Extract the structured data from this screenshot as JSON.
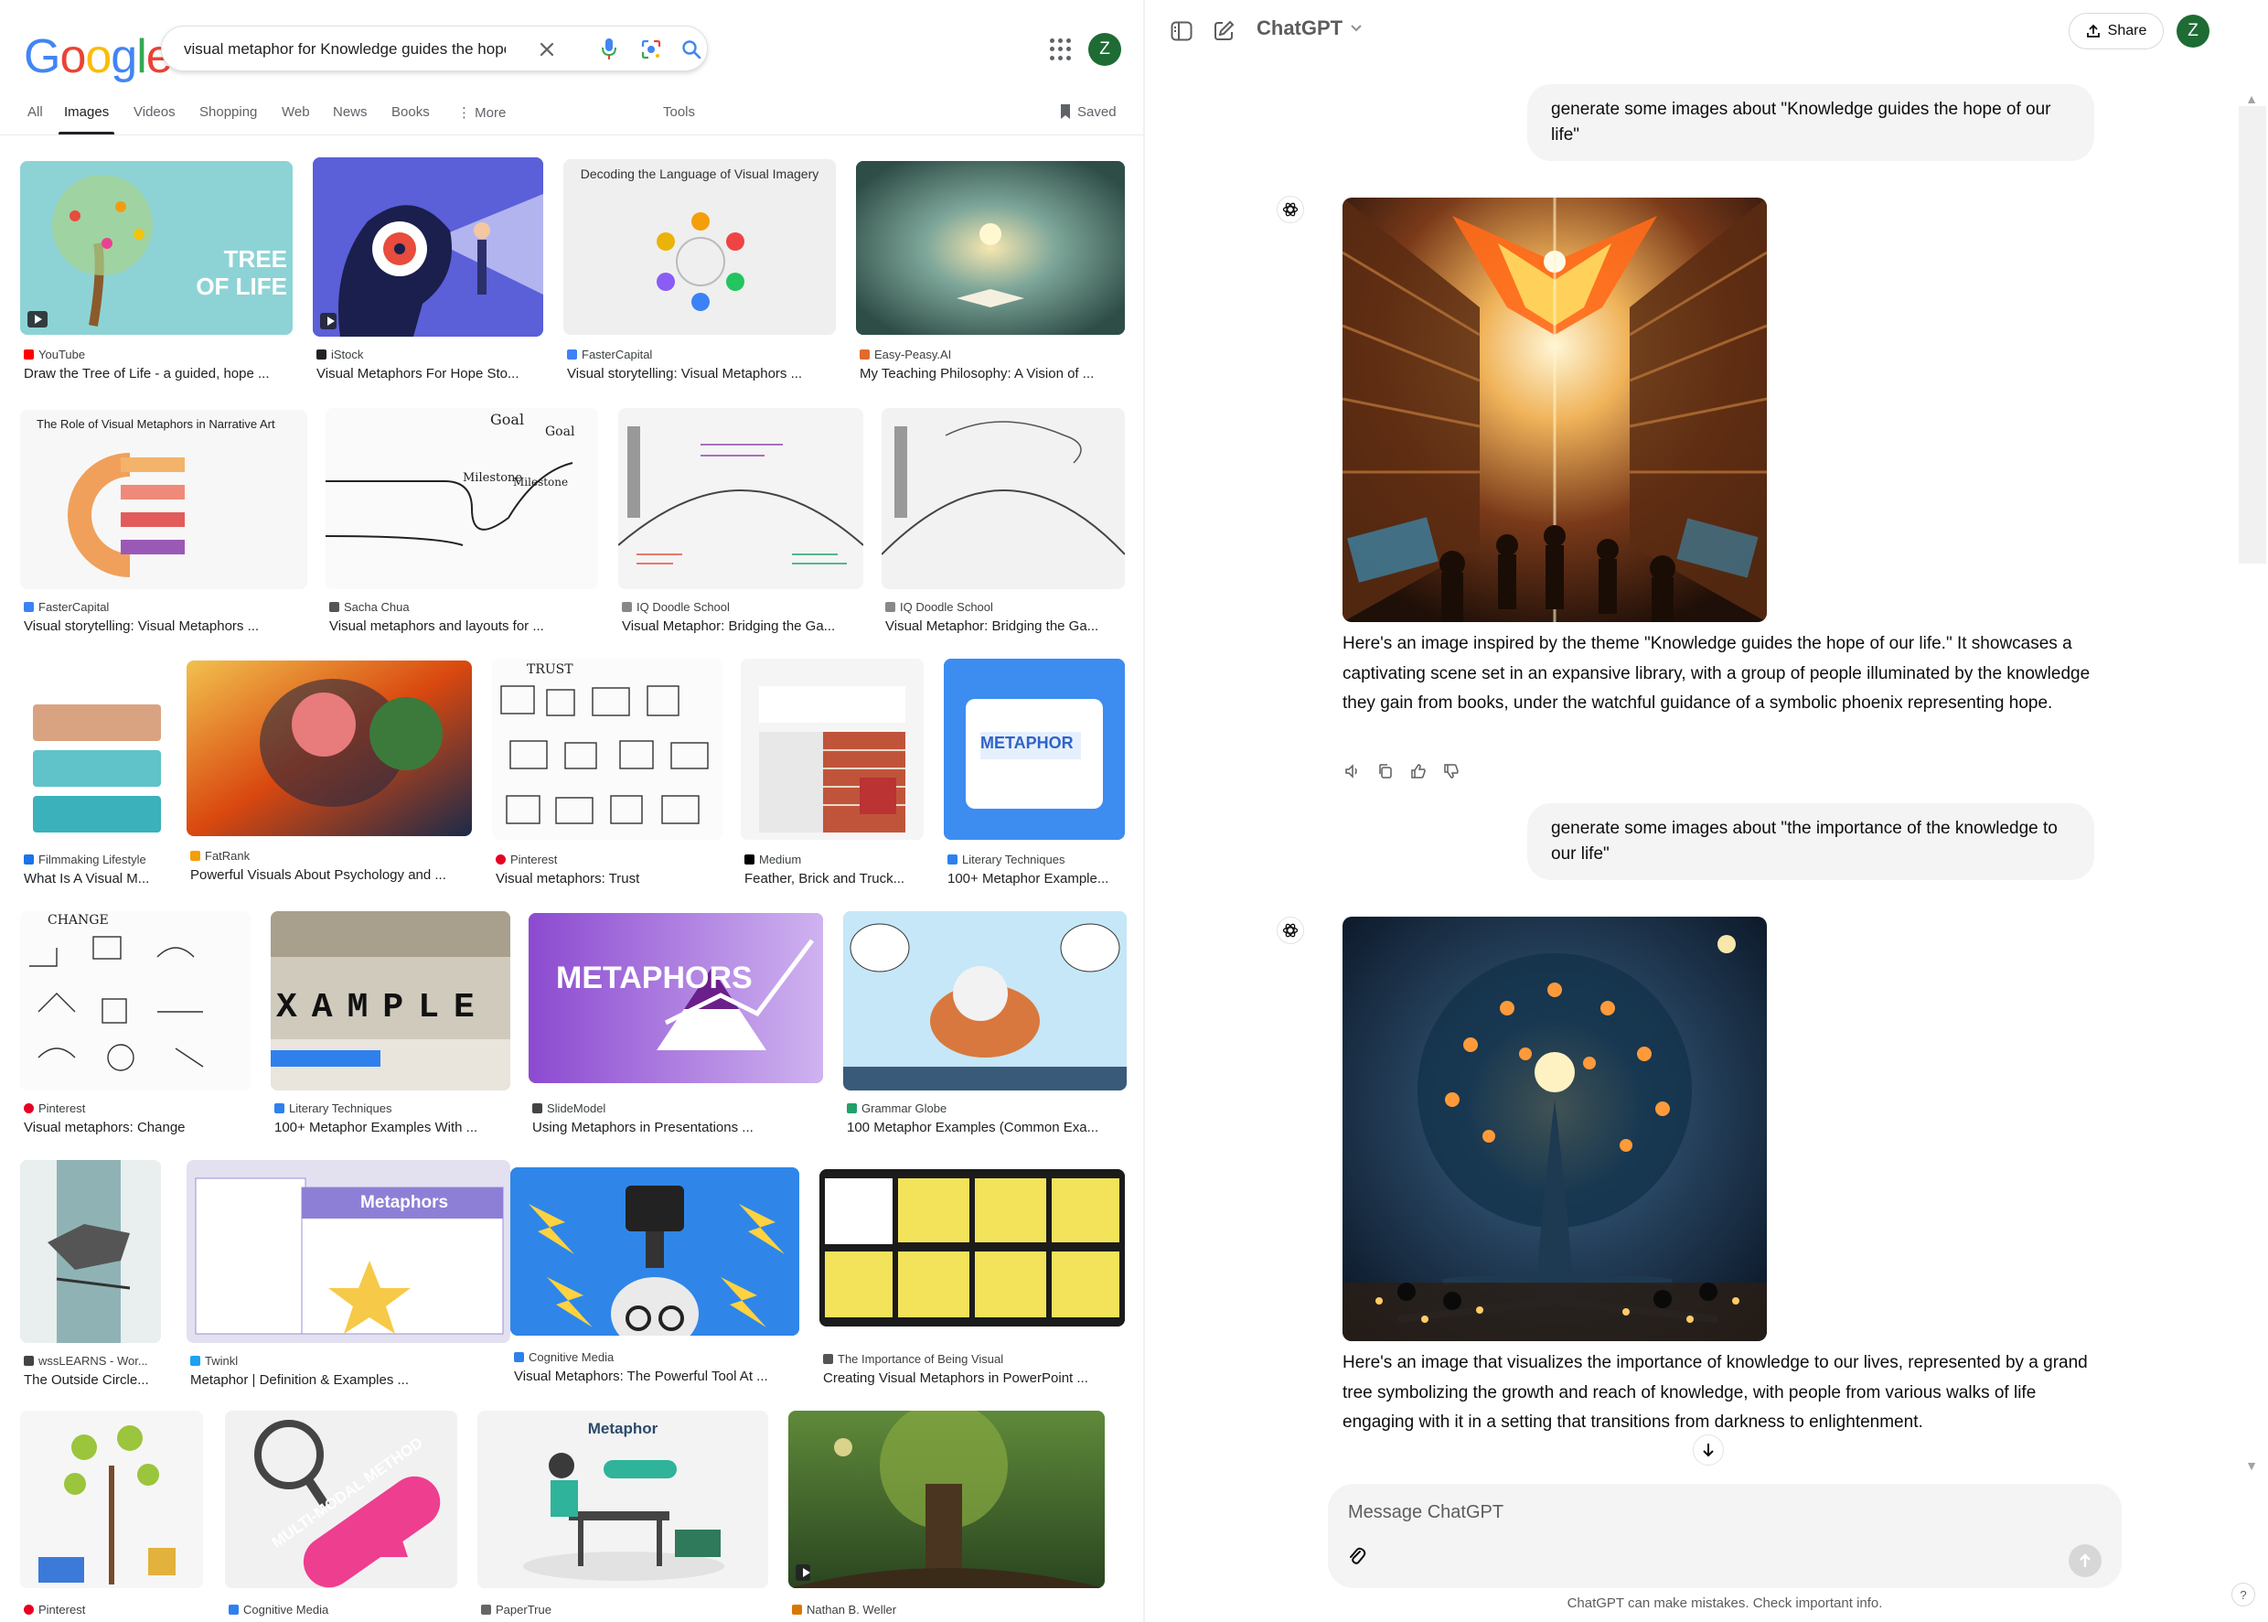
{
  "google": {
    "logo_letters": [
      {
        "ch": "G",
        "color": "#4285F4"
      },
      {
        "ch": "o",
        "color": "#EA4335"
      },
      {
        "ch": "o",
        "color": "#FBBC05"
      },
      {
        "ch": "g",
        "color": "#4285F4"
      },
      {
        "ch": "l",
        "color": "#34A853"
      },
      {
        "ch": "e",
        "color": "#EA4335"
      }
    ],
    "search_query": "visual metaphor for Knowledge guides the hope",
    "avatar_letter": "Z",
    "tabs": [
      "All",
      "Images",
      "Videos",
      "Shopping",
      "Web",
      "News",
      "Books",
      "More",
      "Tools"
    ],
    "active_tab": "Images",
    "saved_label": "Saved",
    "results": [
      {
        "source": "YouTube",
        "title": "Draw the Tree of Life - a guided, hope ...",
        "fav": "#ff0000",
        "thumb_text": "TREE OF LIFE",
        "bg": "#7fcfd0"
      },
      {
        "source": "iStock",
        "title": "Visual Metaphors For Hope Sto...",
        "fav": "#222222",
        "bg": "#5a5fd6"
      },
      {
        "source": "FasterCapital",
        "title": "Visual storytelling: Visual Metaphors ...",
        "fav": "#3b82f6",
        "thumb_text": "Decoding the Language of Visual Imagery",
        "bg": "#efefef"
      },
      {
        "source": "Easy-Peasy.AI",
        "title": "My Teaching Philosophy: A Vision of ...",
        "fav": "#e26a2c",
        "bg": "#3e6a5e"
      },
      {
        "source": "FasterCapital",
        "title": "Visual storytelling: Visual Metaphors ...",
        "fav": "#3b82f6",
        "thumb_text": "The Role of Visual Metaphors in Narrative Art",
        "bg": "#f7f7f7"
      },
      {
        "source": "Sacha Chua",
        "title": "Visual metaphors and layouts for ...",
        "fav": "#555555",
        "bg": "#fafafa"
      },
      {
        "source": "IQ Doodle School",
        "title": "Visual Metaphor: Bridging the Ga...",
        "fav": "#888888",
        "bg": "#f4f4f4"
      },
      {
        "source": "IQ Doodle School",
        "title": "Visual Metaphor: Bridging the Ga...",
        "fav": "#888888",
        "bg": "#f2f2f2"
      },
      {
        "source": "Filmmaking Lifestyle",
        "title": "What Is A Visual M...",
        "fav": "#1a73e8",
        "bg": "#eaf6f8"
      },
      {
        "source": "FatRank",
        "title": "Powerful Visuals About Psychology and ...",
        "fav": "#f59e0b",
        "bg": "#2b2b4a"
      },
      {
        "source": "Pinterest",
        "title": "Visual metaphors: Trust",
        "fav": "#e60023",
        "thumb_text": "TRUST",
        "bg": "#fbfbfb"
      },
      {
        "source": "Medium",
        "title": "Feather, Brick and Truck...",
        "fav": "#000000",
        "bg": "#dcdcdc"
      },
      {
        "source": "Literary Techniques",
        "title": "100+ Metaphor Example...",
        "fav": "#2f80ed",
        "thumb_text": "METAPHOR",
        "bg": "#2f80ed"
      },
      {
        "source": "Pinterest",
        "title": "Visual metaphors: Change",
        "fav": "#e60023",
        "thumb_text": "CHANGE",
        "bg": "#fbfbfb"
      },
      {
        "source": "Literary Techniques",
        "title": "100+ Metaphor Examples With ...",
        "fav": "#2f80ed",
        "thumb_text": "XAMPLE",
        "bg": "#d9d4c8"
      },
      {
        "source": "SlideModel",
        "title": "Using Metaphors in Presentations ...",
        "fav": "#444444",
        "thumb_text": "METAPHORS",
        "bg": "#7b3fb8"
      },
      {
        "source": "Grammar Globe",
        "title": "100 Metaphor Examples (Common Exa...",
        "fav": "#22a06b",
        "bg": "#bfe3f5"
      },
      {
        "source": "wssLEARNS - Wor...",
        "title": "The Outside Circle...",
        "fav": "#444444",
        "bg": "#dfe6e6"
      },
      {
        "source": "Twinkl",
        "title": "Metaphor | Definition & Examples ...",
        "fav": "#1da1f2",
        "thumb_text": "Metaphors",
        "bg": "#e7e4f3"
      },
      {
        "source": "Cognitive Media",
        "title": "Visual Metaphors: The Powerful Tool At ...",
        "fav": "#2f80ed",
        "bg": "#2a7de1"
      },
      {
        "source": "The Importance of Being Visual",
        "title": "Creating Visual Metaphors in PowerPoint ...",
        "fav": "#555555",
        "bg": "#1b1b1b"
      },
      {
        "source": "Pinterest",
        "title": "",
        "fav": "#e60023",
        "bg": "#f5f5f5"
      },
      {
        "source": "Cognitive Media",
        "title": "",
        "fav": "#2f80ed",
        "thumb_text": "MULTI-MODAL METHOD",
        "bg": "#f2f2f2"
      },
      {
        "source": "PaperTrue",
        "title": "",
        "fav": "#666666",
        "thumb_text": "Metaphor",
        "bg": "#f3f3f3"
      },
      {
        "source": "Nathan B. Weller",
        "title": "",
        "fav": "#d97706",
        "bg": "#3a5a2a"
      }
    ]
  },
  "chat": {
    "title": "ChatGPT",
    "share_label": "Share",
    "avatar_letter": "Z",
    "messages": [
      {
        "role": "user",
        "text": "generate some images about \"Knowledge guides the hope of our life\""
      },
      {
        "role": "assistant",
        "text": "Here's an image inspired by the theme \"Knowledge guides the hope of our life.\" It showcases a captivating scene set in an expansive library, with a group of people illuminated by the knowledge they gain from books, under the watchful guidance of a symbolic phoenix representing hope."
      },
      {
        "role": "user",
        "text": "generate some images about \"the importance of the knowledge to our life\""
      },
      {
        "role": "assistant",
        "text": "Here's an image that visualizes the importance of knowledge to our lives, represented by a grand tree symbolizing the growth and reach of knowledge, with people from various walks of life engaging with it in a setting that transitions from darkness to enlightenment."
      }
    ],
    "composer_placeholder": "Message ChatGPT",
    "disclaimer": "ChatGPT can make mistakes. Check important info.",
    "help_label": "?"
  }
}
